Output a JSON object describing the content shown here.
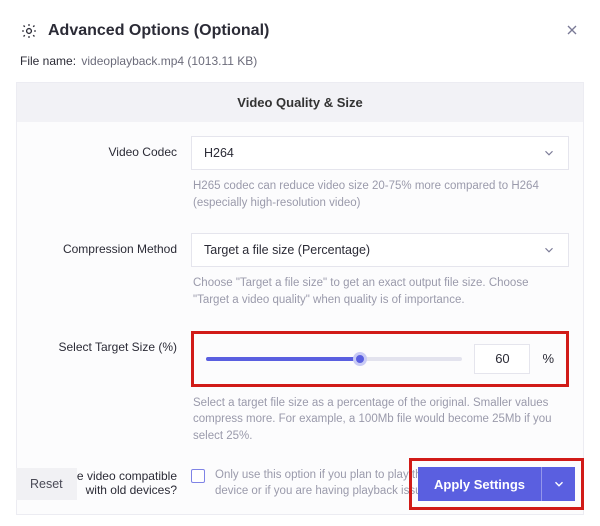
{
  "header": {
    "title": "Advanced Options (Optional)"
  },
  "file": {
    "label": "File name:",
    "value": "videoplayback.mp4 (1013.11 KB)"
  },
  "panel": {
    "title": "Video Quality & Size",
    "codec": {
      "label": "Video Codec",
      "value": "H264",
      "hint": "H265 codec can reduce video size 20-75% more compared to H264 (especially high-resolution video)"
    },
    "method": {
      "label": "Compression Method",
      "value": "Target a file size (Percentage)",
      "hint": "Choose \"Target a file size\" to get an exact output file size. Choose \"Target a video quality\" when quality is of importance."
    },
    "target": {
      "label": "Select Target Size (%)",
      "value": "60",
      "unit": "%",
      "hint": "Select a target file size as a percentage of the original. Smaller values compress more. For example, a 100Mb file would become 25Mb if you select 25%."
    },
    "compat": {
      "label": "Make video compatible with old devices?",
      "hint": "Only use this option if you plan to play the video on a really old device or if you are having playback issues (it compress less)"
    }
  },
  "footer": {
    "reset": "Reset",
    "apply": "Apply Settings"
  }
}
